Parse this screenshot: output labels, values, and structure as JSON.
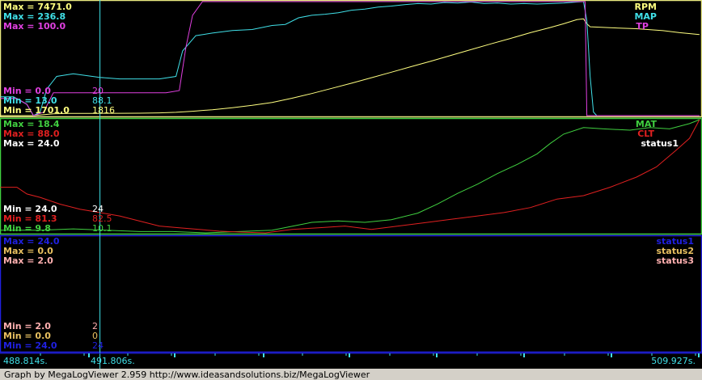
{
  "app": {
    "credit": "Graph by MegaLogViewer 2.959 http://www.ideasandsolutions.biz/MegaLogViewer"
  },
  "colors": {
    "background": "#000000",
    "rpm": "#ffff80",
    "map": "#40e0e8",
    "tp": "#e040e0",
    "mat": "#40d040",
    "clt": "#e02020",
    "status1_p2": "#ffffff",
    "status1_p3": "#2020e0",
    "status2": "#e8c060",
    "status3": "#ffb0b0",
    "cursor": "#40e0e8",
    "panel1_border": "#e8e880",
    "panel2_border": "#40d040",
    "panel3_border": "#2020e0"
  },
  "axis": {
    "start_label": "488.814s.",
    "cursor_label": "491.806s.",
    "end_label": "509.927s."
  },
  "chart_data": [
    {
      "type": "line",
      "x_range": [
        488.814,
        509.927
      ],
      "cursor_x": 491.806,
      "series": [
        {
          "name": "RPM",
          "max_label": "Max = 7471.0",
          "min_label": "Min = 1701.0",
          "cursor_value": "1816",
          "min": 1701.0,
          "max": 7471.0,
          "points": [
            [
              488.8,
              1701
            ],
            [
              489.3,
              1701
            ],
            [
              489.8,
              1701
            ],
            [
              490.4,
              1790
            ],
            [
              490.9,
              1812
            ],
            [
              491.4,
              1813
            ],
            [
              491.8,
              1816
            ],
            [
              492.4,
              1820
            ],
            [
              493.0,
              1822
            ],
            [
              493.6,
              1840
            ],
            [
              494.1,
              1870
            ],
            [
              494.6,
              1920
            ],
            [
              495.2,
              2000
            ],
            [
              495.8,
              2100
            ],
            [
              496.4,
              2220
            ],
            [
              497.0,
              2370
            ],
            [
              497.6,
              2580
            ],
            [
              498.2,
              2820
            ],
            [
              498.8,
              3080
            ],
            [
              499.4,
              3340
            ],
            [
              500.0,
              3620
            ],
            [
              500.6,
              3900
            ],
            [
              501.2,
              4180
            ],
            [
              501.8,
              4460
            ],
            [
              502.4,
              4750
            ],
            [
              503.0,
              5040
            ],
            [
              503.6,
              5330
            ],
            [
              504.2,
              5610
            ],
            [
              504.8,
              5900
            ],
            [
              505.4,
              6160
            ],
            [
              505.8,
              6350
            ],
            [
              506.2,
              6560
            ],
            [
              506.4,
              6600
            ],
            [
              506.5,
              6350
            ],
            [
              506.6,
              6200
            ],
            [
              507.2,
              6150
            ],
            [
              508.0,
              6100
            ],
            [
              508.8,
              6000
            ],
            [
              509.3,
              5900
            ],
            [
              509.9,
              5800
            ]
          ]
        },
        {
          "name": "MAP",
          "max_label": "Max = 236.8",
          "min_label": "Min = 13.0",
          "cursor_value": "88.1",
          "min": 13.0,
          "max": 236.8,
          "points": [
            [
              488.8,
              50
            ],
            [
              489.2,
              50
            ],
            [
              489.6,
              35
            ],
            [
              489.8,
              13
            ],
            [
              490.0,
              20
            ],
            [
              490.2,
              65
            ],
            [
              490.5,
              90
            ],
            [
              491.0,
              95
            ],
            [
              491.8,
              88
            ],
            [
              492.4,
              85
            ],
            [
              493.0,
              85
            ],
            [
              493.6,
              85
            ],
            [
              494.1,
              90
            ],
            [
              494.3,
              140
            ],
            [
              494.7,
              170
            ],
            [
              495.2,
              175
            ],
            [
              495.8,
              180
            ],
            [
              496.4,
              182
            ],
            [
              497.0,
              190
            ],
            [
              497.4,
              192
            ],
            [
              497.8,
              205
            ],
            [
              498.2,
              210
            ],
            [
              498.6,
              212
            ],
            [
              499.0,
              215
            ],
            [
              499.4,
              220
            ],
            [
              499.8,
              222
            ],
            [
              500.2,
              226
            ],
            [
              500.6,
              228
            ],
            [
              501.0,
              231
            ],
            [
              501.4,
              233
            ],
            [
              501.8,
              232
            ],
            [
              502.2,
              235
            ],
            [
              502.6,
              234
            ],
            [
              503.0,
              236
            ],
            [
              503.4,
              233
            ],
            [
              503.8,
              234
            ],
            [
              504.2,
              232
            ],
            [
              504.6,
              233
            ],
            [
              505.0,
              232
            ],
            [
              505.4,
              233
            ],
            [
              505.8,
              234
            ],
            [
              506.2,
              236
            ],
            [
              506.4,
              236.8
            ],
            [
              506.5,
              200
            ],
            [
              506.6,
              90
            ],
            [
              506.7,
              20
            ],
            [
              506.8,
              13
            ],
            [
              507.5,
              13
            ],
            [
              508.5,
              13
            ],
            [
              509.9,
              13
            ]
          ]
        },
        {
          "name": "TP",
          "max_label": "Max = 100.0",
          "min_label": "Min = 0.0",
          "cursor_value": "20",
          "min": 0.0,
          "max": 100.0,
          "points": [
            [
              488.8,
              15
            ],
            [
              489.3,
              15
            ],
            [
              489.6,
              10
            ],
            [
              489.8,
              0
            ],
            [
              490.1,
              3
            ],
            [
              490.4,
              20
            ],
            [
              491.0,
              20
            ],
            [
              491.8,
              20
            ],
            [
              492.5,
              20
            ],
            [
              493.2,
              20
            ],
            [
              493.8,
              20
            ],
            [
              494.2,
              22
            ],
            [
              494.4,
              60
            ],
            [
              494.6,
              88
            ],
            [
              494.9,
              100
            ],
            [
              495.5,
              100
            ],
            [
              500.0,
              100
            ],
            [
              505.0,
              100
            ],
            [
              506.3,
              100
            ],
            [
              506.45,
              100
            ],
            [
              506.5,
              0
            ],
            [
              507.0,
              0
            ],
            [
              508.0,
              0
            ],
            [
              509.9,
              0
            ]
          ]
        }
      ]
    },
    {
      "type": "line",
      "x_range": [
        488.814,
        509.927
      ],
      "cursor_x": 491.806,
      "series": [
        {
          "name": "MAT",
          "max_label": "Max = 18.4",
          "min_label": "Min = 9.8",
          "cursor_value": "10.1",
          "min": 9.8,
          "max": 18.4,
          "points": [
            [
              488.8,
              10.0
            ],
            [
              490.0,
              10.0
            ],
            [
              491.0,
              10.1
            ],
            [
              492.0,
              10.0
            ],
            [
              493.0,
              9.9
            ],
            [
              494.0,
              9.9
            ],
            [
              495.0,
              9.8
            ],
            [
              496.0,
              9.9
            ],
            [
              497.0,
              10.0
            ],
            [
              497.6,
              10.3
            ],
            [
              498.2,
              10.6
            ],
            [
              499.0,
              10.7
            ],
            [
              499.8,
              10.6
            ],
            [
              500.6,
              10.8
            ],
            [
              501.4,
              11.3
            ],
            [
              502.0,
              12.0
            ],
            [
              502.6,
              12.8
            ],
            [
              503.2,
              13.5
            ],
            [
              503.8,
              14.3
            ],
            [
              504.4,
              15.0
            ],
            [
              505.0,
              15.8
            ],
            [
              505.4,
              16.6
            ],
            [
              505.8,
              17.3
            ],
            [
              506.4,
              17.8
            ],
            [
              507.0,
              17.7
            ],
            [
              507.8,
              17.6
            ],
            [
              508.4,
              17.8
            ],
            [
              509.0,
              17.7
            ],
            [
              509.6,
              18.1
            ],
            [
              509.9,
              18.4
            ]
          ]
        },
        {
          "name": "CLT",
          "max_label": "Max = 88.0",
          "min_label": "Min = 81.3",
          "cursor_value": "82.5",
          "min": 81.3,
          "max": 88.0,
          "points": [
            [
              488.8,
              84.0
            ],
            [
              489.3,
              84.0
            ],
            [
              489.6,
              83.6
            ],
            [
              490.0,
              83.4
            ],
            [
              490.6,
              83.0
            ],
            [
              491.2,
              82.7
            ],
            [
              491.8,
              82.5
            ],
            [
              492.4,
              82.3
            ],
            [
              493.0,
              82.0
            ],
            [
              493.6,
              81.7
            ],
            [
              494.2,
              81.6
            ],
            [
              494.8,
              81.5
            ],
            [
              495.4,
              81.4
            ],
            [
              496.0,
              81.35
            ],
            [
              496.8,
              81.3
            ],
            [
              497.6,
              81.5
            ],
            [
              498.4,
              81.6
            ],
            [
              499.2,
              81.7
            ],
            [
              500.0,
              81.5
            ],
            [
              500.8,
              81.7
            ],
            [
              501.6,
              81.9
            ],
            [
              502.4,
              82.1
            ],
            [
              503.2,
              82.3
            ],
            [
              504.0,
              82.5
            ],
            [
              504.8,
              82.8
            ],
            [
              505.6,
              83.3
            ],
            [
              506.4,
              83.5
            ],
            [
              507.2,
              84.0
            ],
            [
              508.0,
              84.6
            ],
            [
              508.6,
              85.2
            ],
            [
              509.2,
              86.2
            ],
            [
              509.6,
              86.9
            ],
            [
              509.9,
              88.0
            ]
          ]
        },
        {
          "name": "status1",
          "max_label": "Max = 24.0",
          "min_label": "Min = 24.0",
          "cursor_value": "24",
          "min": 24.0,
          "max": 24.0,
          "points": []
        }
      ]
    },
    {
      "type": "line",
      "x_range": [
        488.814,
        509.927
      ],
      "cursor_x": 491.806,
      "series": [
        {
          "name": "status1",
          "max_label": "Max = 24.0",
          "min_label": "Min = 24.0",
          "cursor_value": "24",
          "min": 24.0,
          "max": 24.0,
          "points": []
        },
        {
          "name": "status2",
          "max_label": "Max = 0.0",
          "min_label": "Min = 0.0",
          "cursor_value": "0",
          "min": 0.0,
          "max": 0.0,
          "points": []
        },
        {
          "name": "status3",
          "max_label": "Max = 2.0",
          "min_label": "Min = 2.0",
          "cursor_value": "2",
          "min": 2.0,
          "max": 2.0,
          "points": []
        }
      ]
    }
  ]
}
